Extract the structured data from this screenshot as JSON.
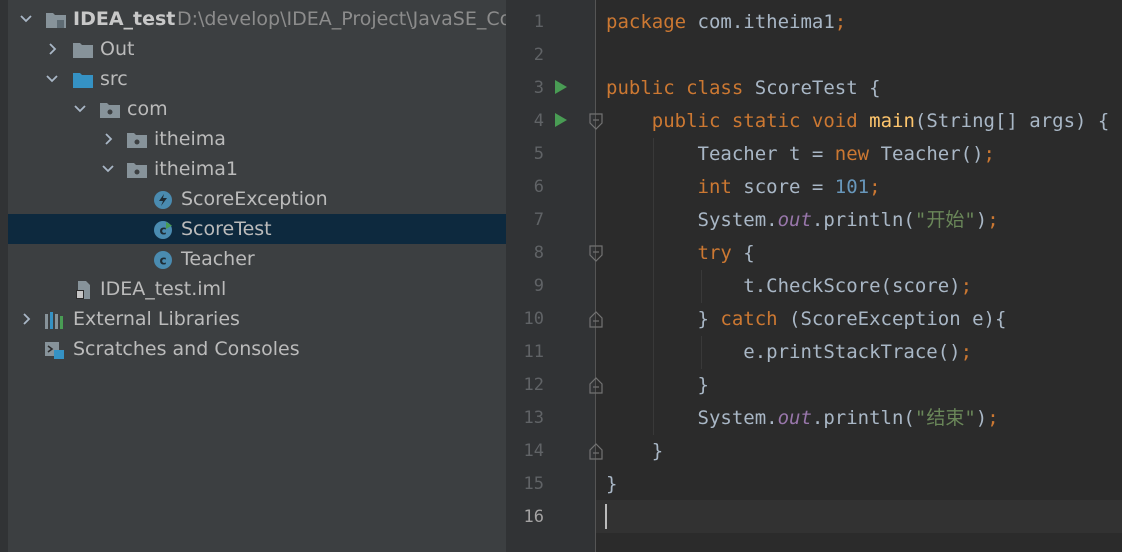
{
  "project_tree": {
    "root": {
      "name": "IDEA_test",
      "path": "D:\\develop\\IDEA_Project\\JavaSE_Code\\I"
    },
    "out": "Out",
    "src": "src",
    "com": "com",
    "itheima": "itheima",
    "itheima1": "itheima1",
    "score_exception": "ScoreException",
    "score_test": "ScoreTest",
    "teacher": "Teacher",
    "iml": "IDEA_test.iml",
    "external_libraries": "External Libraries",
    "scratches": "Scratches and Consoles"
  },
  "editor": {
    "line_numbers": [
      "1",
      "2",
      "3",
      "4",
      "5",
      "6",
      "7",
      "8",
      "9",
      "10",
      "11",
      "12",
      "13",
      "14",
      "15",
      "16"
    ],
    "current_line": "16",
    "code": {
      "l1": {
        "kw": "package",
        "rest": " com.itheima1",
        "semi": ";"
      },
      "l3": {
        "kw": "public class",
        "rest": " ScoreTest {"
      },
      "l4": {
        "indent": "    ",
        "kw": "public static void",
        "sp": " ",
        "fn": "main",
        "rest": "(String[] args) {"
      },
      "l5": {
        "indent": "        ",
        "a": "Teacher t = ",
        "kw": "new",
        "b": " Teacher()",
        "semi": ";"
      },
      "l6": {
        "indent": "        ",
        "kw": "int",
        "a": " score = ",
        "num": "101",
        "semi": ";"
      },
      "l7": {
        "indent": "        ",
        "a": "System.",
        "st": "out",
        "b": ".println(",
        "str": "\"开始\"",
        "c": ")",
        "semi": ";"
      },
      "l8": {
        "indent": "        ",
        "kw": "try",
        "rest": " {"
      },
      "l9": {
        "indent": "            ",
        "a": "t.CheckScore(score)",
        "semi": ";"
      },
      "l10": {
        "indent": "        ",
        "a": "} ",
        "kw": "catch",
        "rest": " (ScoreException e){"
      },
      "l11": {
        "indent": "            ",
        "a": "e.printStackTrace()",
        "semi": ";"
      },
      "l12": {
        "indent": "        ",
        "a": "}"
      },
      "l13": {
        "indent": "        ",
        "a": "System.",
        "st": "out",
        "b": ".println(",
        "str": "\"结束\"",
        "c": ")",
        "semi": ";"
      },
      "l14": {
        "indent": "    ",
        "a": "}"
      },
      "l15": {
        "a": "}"
      }
    }
  },
  "colors": {
    "keyword": "#cc7832",
    "number": "#6897bb",
    "string": "#6a8759",
    "method_decl": "#ffc66d",
    "static_field": "#9876aa",
    "selection": "#0d293e",
    "run_icon": "#499c54"
  }
}
